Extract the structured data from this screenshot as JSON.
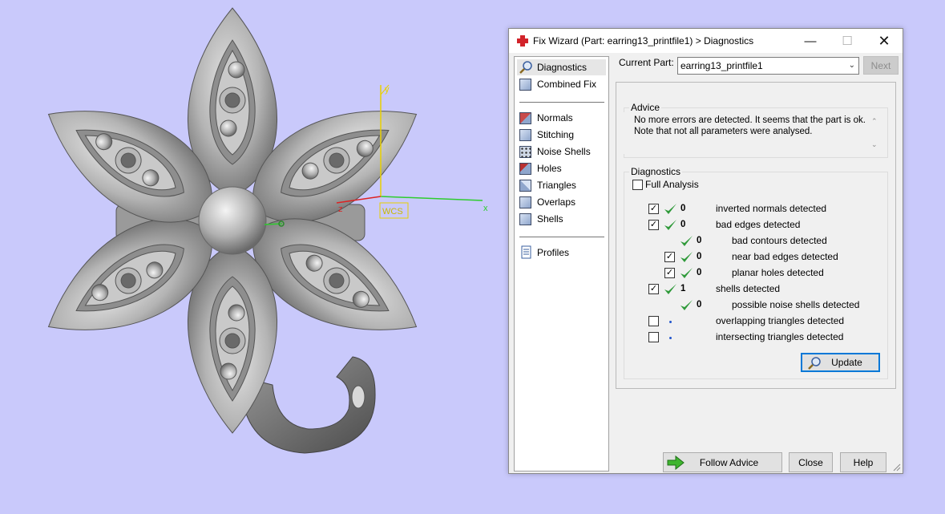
{
  "viewport": {
    "axis_labels": {
      "x": "x",
      "y": "y",
      "z": "z",
      "origin": "WCS"
    },
    "colors": {
      "background": "#c9c9fb",
      "model": "#a8a8a8",
      "x_axis": "#2ecc2e",
      "y_axis": "#e8d000",
      "z_axis": "#d22"
    }
  },
  "dialog": {
    "title": "Fix Wizard (Part: earring13_printfile1) > Diagnostics",
    "window_controls": {
      "minimize": "—",
      "maximize": "☐",
      "close": "✕"
    },
    "nav_top": [
      {
        "label": "Diagnostics",
        "icon": "magnifier-icon",
        "selected": true
      },
      {
        "label": "Combined Fix",
        "icon": "combined-fix-cube-icon",
        "selected": false
      }
    ],
    "nav_fixes": [
      {
        "label": "Normals",
        "icon": "normals-cube-icon"
      },
      {
        "label": "Stitching",
        "icon": "stitching-cube-icon"
      },
      {
        "label": "Noise Shells",
        "icon": "noise-shells-cube-icon"
      },
      {
        "label": "Holes",
        "icon": "holes-cube-icon"
      },
      {
        "label": "Triangles",
        "icon": "triangles-cube-icon"
      },
      {
        "label": "Overlaps",
        "icon": "overlaps-cube-icon"
      },
      {
        "label": "Shells",
        "icon": "shells-cube-icon"
      }
    ],
    "nav_bottom": [
      {
        "label": "Profiles",
        "icon": "document-icon"
      }
    ],
    "current_part_label": "Current Part:",
    "current_part_value": "earring13_printfile1",
    "next_label": "Next",
    "advice": {
      "title": "Advice",
      "line1": "No more errors are detected. It seems that the part is ok.",
      "line2": "Note that not all parameters were analysed."
    },
    "diagnostics": {
      "title": "Diagnostics",
      "full_analysis_label": "Full Analysis",
      "full_analysis_checked": false,
      "rows": [
        {
          "label": "inverted normals detected",
          "count": "0",
          "checked": true,
          "status": "ok"
        },
        {
          "label": "bad edges detected",
          "count": "0",
          "checked": true,
          "status": "ok"
        },
        {
          "label": "bad contours detected",
          "count": "0",
          "checked": null,
          "status": "ok"
        },
        {
          "label": "near bad edges detected",
          "count": "0",
          "checked": true,
          "status": "ok"
        },
        {
          "label": "planar holes detected",
          "count": "0",
          "checked": true,
          "status": "ok"
        },
        {
          "label": "shells detected",
          "count": "1",
          "checked": true,
          "status": "ok"
        },
        {
          "label": "possible noise shells detected",
          "count": "0",
          "checked": null,
          "status": "ok"
        },
        {
          "label": "overlapping triangles detected",
          "count": "",
          "checked": false,
          "status": "none"
        },
        {
          "label": "intersecting triangles detected",
          "count": "",
          "checked": false,
          "status": "none"
        }
      ],
      "update_label": "Update"
    },
    "follow_advice_label": "Follow Advice",
    "close_label": "Close",
    "help_label": "Help"
  }
}
